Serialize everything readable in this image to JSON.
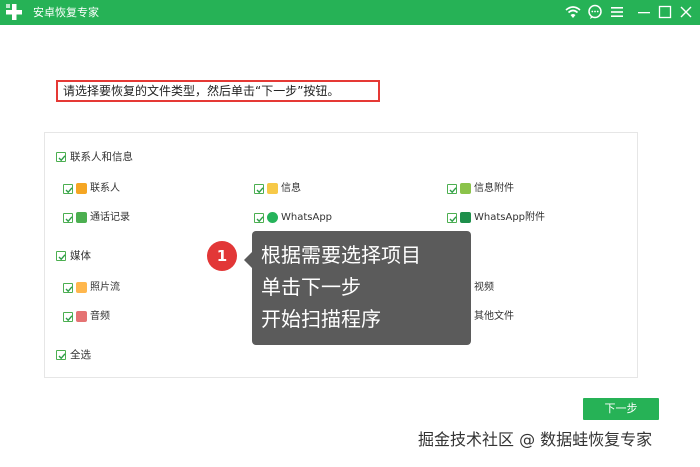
{
  "window": {
    "title": "安卓恢复专家"
  },
  "instruction": "请选择要恢复的文件类型，然后单击“下一步”按钮。",
  "groups": {
    "contacts_messages": {
      "label": "联系人和信息",
      "items": {
        "contacts": "联系人",
        "messages": "信息",
        "message_attachments": "信息附件",
        "call_logs": "通话记录",
        "whatsapp": "WhatsApp",
        "whatsapp_attachments": "WhatsApp附件"
      }
    },
    "media": {
      "label": "媒体",
      "items": {
        "photo_stream": "照片流",
        "video": "视频",
        "audio": "音频",
        "other_files": "其他文件"
      }
    },
    "select_all": "全选"
  },
  "tooltip": {
    "badge": "1",
    "lines": [
      "根据需要选择项目",
      "单击下一步",
      "开始扫描程序"
    ]
  },
  "next_button": "下一步",
  "watermark": "掘金技术社区 @ 数据蛙恢复专家",
  "colors": {
    "brand": "#26b256",
    "highlight_border": "#e53935",
    "badge": "#e23737",
    "tooltip_bg": "#5b5b5b"
  },
  "icons": [
    "wifi-icon",
    "chat-icon",
    "menu-icon",
    "minimize-icon",
    "maximize-icon",
    "close-icon"
  ]
}
